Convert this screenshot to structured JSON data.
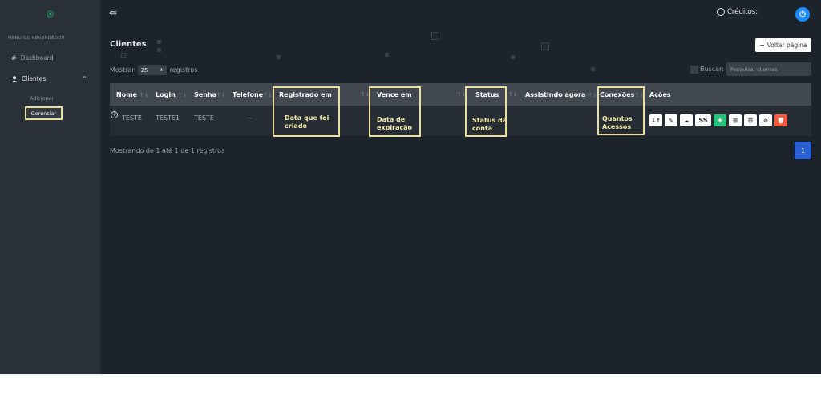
{
  "sidebar": {
    "menu_title": "MENU DO REVENDEDOR",
    "items": [
      {
        "icon": "#",
        "label": "Dashboard"
      },
      {
        "icon": "user-icon",
        "label": "Clientes"
      }
    ],
    "submenu": {
      "add": "Adicionar",
      "manage": "Gerenciar"
    }
  },
  "header": {
    "menu_icon": "⇚",
    "credits_label": "Créditos:"
  },
  "main": {
    "title": "Clientes",
    "back_button": "Voltar página",
    "show_prefix": "Mostrar",
    "show_value": "25",
    "show_suffix": "registros",
    "search_label": "Buscar:",
    "search_placeholder": "Pesquisar clientes"
  },
  "table": {
    "columns": [
      "Nome",
      "Login",
      "Senha",
      "Telefone",
      "Registrado em",
      "Vence em",
      "Status",
      "Assistindo agora",
      "Conexões",
      "Ações"
    ],
    "row": {
      "nome": "TESTE",
      "login": "TESTE1",
      "senha": "TESTE",
      "telefone": "--"
    }
  },
  "notes": {
    "registrado": "Data que foi criado",
    "vence": "Data de expiração",
    "status": "Status da conta",
    "conexoes": "Quantos Acessos"
  },
  "actions": {
    "ss": "SS"
  },
  "footer": {
    "info": "Mostrando de 1 até 1 de 1 registros",
    "page": "1"
  },
  "colors": {
    "highlight": "#e8df9a",
    "accent": "#1a8cff",
    "green": "#2cc07a",
    "red": "#f25c3f"
  }
}
